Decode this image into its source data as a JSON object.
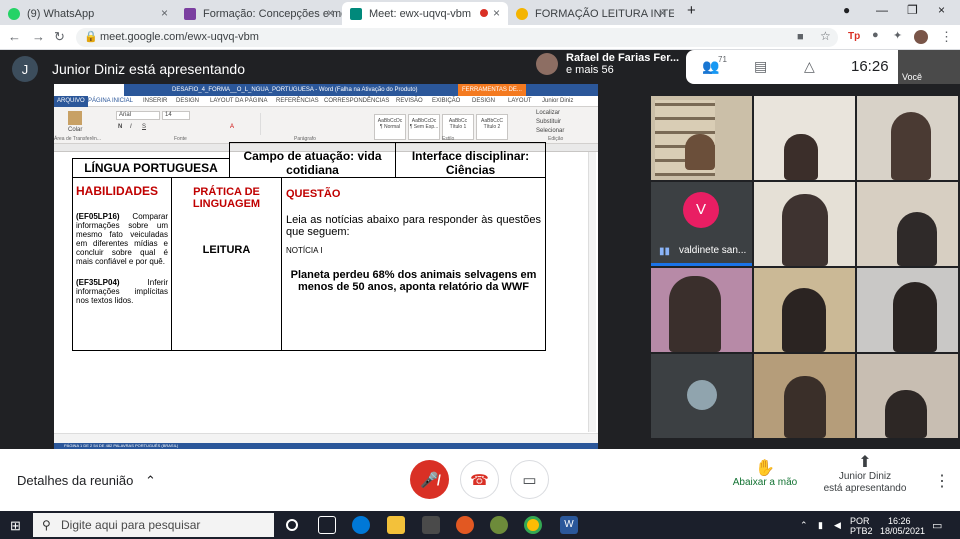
{
  "browser": {
    "tabs": [
      {
        "label": "(9) WhatsApp",
        "color": "#25d366"
      },
      {
        "label": "Formação: Concepções e modelo",
        "color": "#7b3fa0"
      },
      {
        "label": "Meet: ewx-uqvq-vbm",
        "color": "#00897b"
      },
      {
        "label": "FORMAÇÃO LEITURA INTEGRA",
        "color": "#f4b400"
      }
    ],
    "new_tab": "+",
    "url": "meet.google.com/ewx-uqvq-vbm",
    "close_symbol": "×"
  },
  "meet": {
    "presenter_initial": "J",
    "presenter_text": "Junior Diniz está apresentando",
    "user_chip": {
      "name": "Rafael de Farias Fer...",
      "others": "e mais 56"
    },
    "participants_count": "71",
    "clock": "16:26",
    "self_label": "Você",
    "tile_name": "valdinete san...",
    "tile_initial": "V",
    "accent": "#1a73e8"
  },
  "word": {
    "title": "DESAFIO_4_FORMA__O_L_NGUA_PORTUGUESA - Word (Falha na Ativação do Produto)",
    "tools_tab": "FERRAMENTAS DE...",
    "menu": [
      "ARQUIVO",
      "PÁGINA INICIAL",
      "INSERIR",
      "DESIGN",
      "LAYOUT DA PÁGINA",
      "REFERÊNCIAS",
      "CORRESPONDÊNCIAS",
      "REVISÃO",
      "EXIBIÇÃO",
      "DESIGN",
      "LAYOUT",
      "Junior Diniz"
    ],
    "font_name": "Arial",
    "font_size": "14",
    "paste_label": "Colar",
    "styles": [
      {
        "sample": "AaBbCcDc",
        "name": "¶ Normal"
      },
      {
        "sample": "AaBbCcDc",
        "name": "¶ Sem Esp..."
      },
      {
        "sample": "AaBbCc",
        "name": "Título 1"
      },
      {
        "sample": "AaBbCcC",
        "name": "Título 2"
      }
    ],
    "edit_items": [
      "Localizar",
      "Substituir",
      "Selecionar"
    ],
    "groups": [
      "Área de Transferên...",
      "Fonte",
      "Parágrafo",
      "Estilo",
      "Edição"
    ]
  },
  "doc": {
    "row_top": [
      "LÍNGUA PORTUGUESA",
      "Campo de atuação: vida cotidiana",
      "Interface disciplinar: Ciências"
    ],
    "habilidades_header": "HABILIDADES",
    "hab1_code": "(EF05LP16)",
    "hab1_text": "Comparar informações sobre um mesmo fato veiculadas em diferentes mídias e concluir sobre qual é mais confiável e por quê.",
    "hab2_code": "(EF35LP04)",
    "hab2_text": "Inferir informações implícitas nos textos lidos.",
    "pratica_header": "PRÁTICA DE LINGUAGEM",
    "pratica_value": "LEITURA",
    "questao_header": "QUESTÃO",
    "questao_instr": "Leia as notícias abaixo para responder às questões que seguem:",
    "noticia_label": "NOTÍCIA I",
    "headline": "Planeta perdeu 68% dos animais selvagens em menos de 50 anos, aponta relatório da WWF",
    "status": "PÁGINA 1 DE 2    54 DE 482 PALAVRAS    PORTUGUÊS (BRASIL)"
  },
  "controls": {
    "details": "Detalhes da reunião",
    "raise_hand": "Abaixar a mão",
    "presenting_line1": "Junior Diniz",
    "presenting_line2": "está apresentando"
  },
  "taskbar": {
    "search": "Digite aqui para pesquisar",
    "lang1": "POR",
    "lang2": "PTB2",
    "time": "16:26",
    "date": "18/05/2021"
  }
}
